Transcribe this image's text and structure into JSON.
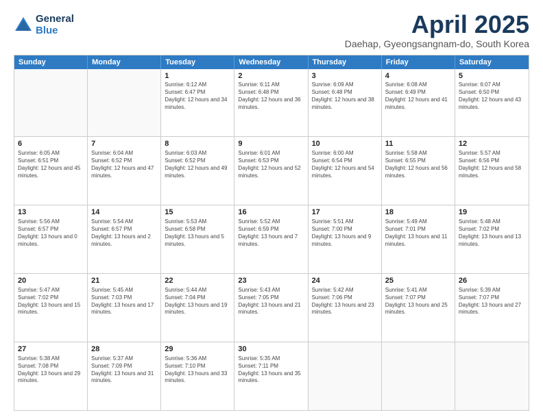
{
  "logo": {
    "general": "General",
    "blue": "Blue"
  },
  "header": {
    "month": "April 2025",
    "location": "Daehap, Gyeongsangnam-do, South Korea"
  },
  "days": [
    "Sunday",
    "Monday",
    "Tuesday",
    "Wednesday",
    "Thursday",
    "Friday",
    "Saturday"
  ],
  "weeks": [
    [
      {
        "day": "",
        "info": ""
      },
      {
        "day": "",
        "info": ""
      },
      {
        "day": "1",
        "info": "Sunrise: 6:12 AM\nSunset: 6:47 PM\nDaylight: 12 hours and 34 minutes."
      },
      {
        "day": "2",
        "info": "Sunrise: 6:11 AM\nSunset: 6:48 PM\nDaylight: 12 hours and 36 minutes."
      },
      {
        "day": "3",
        "info": "Sunrise: 6:09 AM\nSunset: 6:48 PM\nDaylight: 12 hours and 38 minutes."
      },
      {
        "day": "4",
        "info": "Sunrise: 6:08 AM\nSunset: 6:49 PM\nDaylight: 12 hours and 41 minutes."
      },
      {
        "day": "5",
        "info": "Sunrise: 6:07 AM\nSunset: 6:50 PM\nDaylight: 12 hours and 43 minutes."
      }
    ],
    [
      {
        "day": "6",
        "info": "Sunrise: 6:05 AM\nSunset: 6:51 PM\nDaylight: 12 hours and 45 minutes."
      },
      {
        "day": "7",
        "info": "Sunrise: 6:04 AM\nSunset: 6:52 PM\nDaylight: 12 hours and 47 minutes."
      },
      {
        "day": "8",
        "info": "Sunrise: 6:03 AM\nSunset: 6:52 PM\nDaylight: 12 hours and 49 minutes."
      },
      {
        "day": "9",
        "info": "Sunrise: 6:01 AM\nSunset: 6:53 PM\nDaylight: 12 hours and 52 minutes."
      },
      {
        "day": "10",
        "info": "Sunrise: 6:00 AM\nSunset: 6:54 PM\nDaylight: 12 hours and 54 minutes."
      },
      {
        "day": "11",
        "info": "Sunrise: 5:58 AM\nSunset: 6:55 PM\nDaylight: 12 hours and 56 minutes."
      },
      {
        "day": "12",
        "info": "Sunrise: 5:57 AM\nSunset: 6:56 PM\nDaylight: 12 hours and 58 minutes."
      }
    ],
    [
      {
        "day": "13",
        "info": "Sunrise: 5:56 AM\nSunset: 6:57 PM\nDaylight: 13 hours and 0 minutes."
      },
      {
        "day": "14",
        "info": "Sunrise: 5:54 AM\nSunset: 6:57 PM\nDaylight: 13 hours and 2 minutes."
      },
      {
        "day": "15",
        "info": "Sunrise: 5:53 AM\nSunset: 6:58 PM\nDaylight: 13 hours and 5 minutes."
      },
      {
        "day": "16",
        "info": "Sunrise: 5:52 AM\nSunset: 6:59 PM\nDaylight: 13 hours and 7 minutes."
      },
      {
        "day": "17",
        "info": "Sunrise: 5:51 AM\nSunset: 7:00 PM\nDaylight: 13 hours and 9 minutes."
      },
      {
        "day": "18",
        "info": "Sunrise: 5:49 AM\nSunset: 7:01 PM\nDaylight: 13 hours and 11 minutes."
      },
      {
        "day": "19",
        "info": "Sunrise: 5:48 AM\nSunset: 7:02 PM\nDaylight: 13 hours and 13 minutes."
      }
    ],
    [
      {
        "day": "20",
        "info": "Sunrise: 5:47 AM\nSunset: 7:02 PM\nDaylight: 13 hours and 15 minutes."
      },
      {
        "day": "21",
        "info": "Sunrise: 5:45 AM\nSunset: 7:03 PM\nDaylight: 13 hours and 17 minutes."
      },
      {
        "day": "22",
        "info": "Sunrise: 5:44 AM\nSunset: 7:04 PM\nDaylight: 13 hours and 19 minutes."
      },
      {
        "day": "23",
        "info": "Sunrise: 5:43 AM\nSunset: 7:05 PM\nDaylight: 13 hours and 21 minutes."
      },
      {
        "day": "24",
        "info": "Sunrise: 5:42 AM\nSunset: 7:06 PM\nDaylight: 13 hours and 23 minutes."
      },
      {
        "day": "25",
        "info": "Sunrise: 5:41 AM\nSunset: 7:07 PM\nDaylight: 13 hours and 25 minutes."
      },
      {
        "day": "26",
        "info": "Sunrise: 5:39 AM\nSunset: 7:07 PM\nDaylight: 13 hours and 27 minutes."
      }
    ],
    [
      {
        "day": "27",
        "info": "Sunrise: 5:38 AM\nSunset: 7:08 PM\nDaylight: 13 hours and 29 minutes."
      },
      {
        "day": "28",
        "info": "Sunrise: 5:37 AM\nSunset: 7:09 PM\nDaylight: 13 hours and 31 minutes."
      },
      {
        "day": "29",
        "info": "Sunrise: 5:36 AM\nSunset: 7:10 PM\nDaylight: 13 hours and 33 minutes."
      },
      {
        "day": "30",
        "info": "Sunrise: 5:35 AM\nSunset: 7:11 PM\nDaylight: 13 hours and 35 minutes."
      },
      {
        "day": "",
        "info": ""
      },
      {
        "day": "",
        "info": ""
      },
      {
        "day": "",
        "info": ""
      }
    ]
  ]
}
